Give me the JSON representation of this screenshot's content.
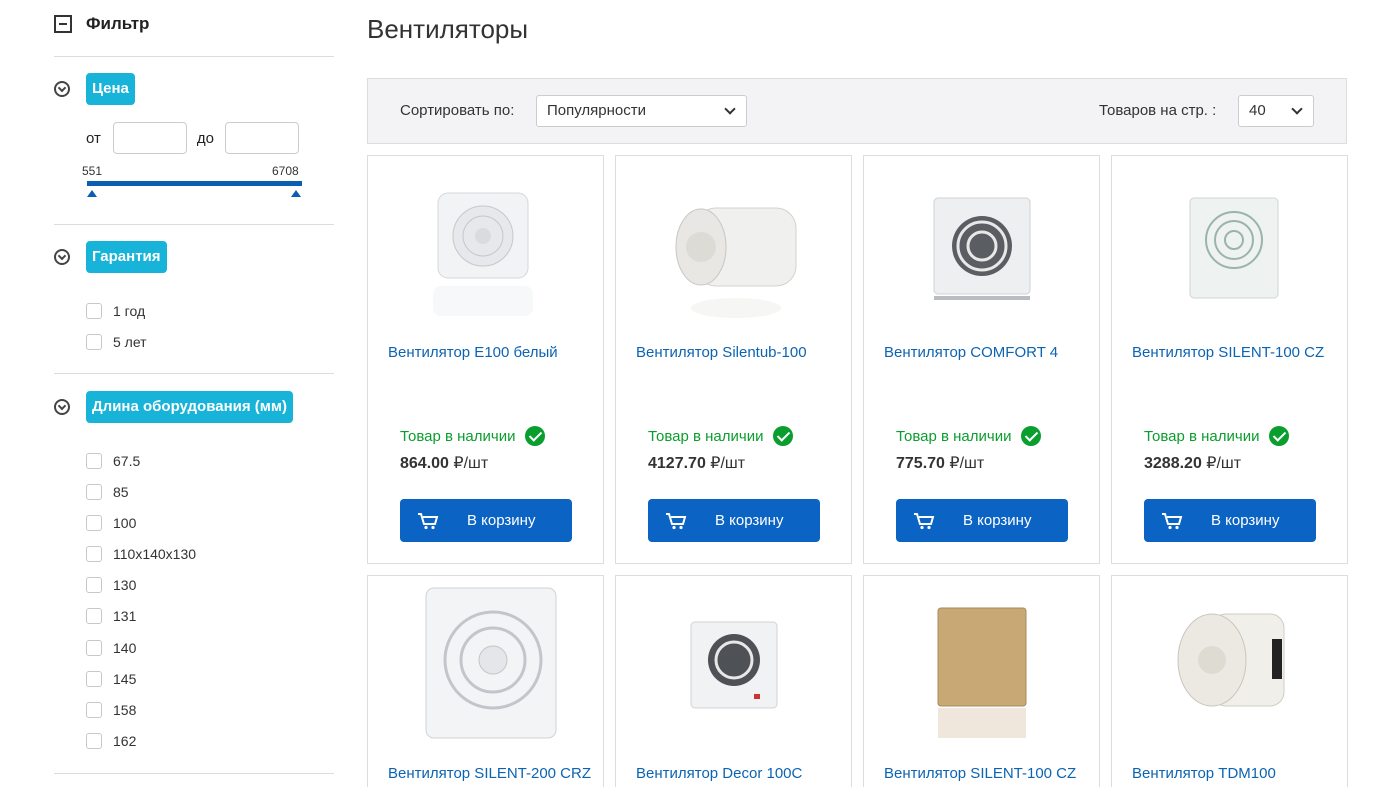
{
  "sidebar": {
    "filter_title": "Фильтр",
    "price": {
      "label": "Цена",
      "from_label": "от",
      "to_label": "до",
      "from_value": "",
      "to_value": "",
      "min": "551",
      "max": "6708"
    },
    "warranty": {
      "label": "Гарантия",
      "options": [
        "1 год",
        "5 лет"
      ]
    },
    "length": {
      "label": "Длина оборудования (мм)",
      "options": [
        "67.5",
        "85",
        "100",
        "110x140x130",
        "130",
        "131",
        "140",
        "145",
        "158",
        "162"
      ]
    }
  },
  "main": {
    "title": "Вентиляторы",
    "toolbar": {
      "sort_label": "Сортировать по:",
      "sort_value": "Популярности",
      "per_page_label": "Товаров на стр. :",
      "per_page_value": "40"
    },
    "products": [
      {
        "name": "Вентилятор E100 белый",
        "availability": "Товар в наличии",
        "price": "864.00",
        "unit": "₽/шт",
        "button": "В корзину"
      },
      {
        "name": "Вентилятор Silentub-100",
        "availability": "Товар в наличии",
        "price": "4127.70",
        "unit": "₽/шт",
        "button": "В корзину"
      },
      {
        "name": "Вентилятор COMFORT 4",
        "availability": "Товар в наличии",
        "price": "775.70",
        "unit": "₽/шт",
        "button": "В корзину"
      },
      {
        "name": "Вентилятор SILENT-100 CZ",
        "availability": "Товар в наличии",
        "price": "3288.20",
        "unit": "₽/шт",
        "button": "В корзину"
      },
      {
        "name": "Вентилятор SILENT-200 CRZ"
      },
      {
        "name": "Вентилятор Decor 100C"
      },
      {
        "name": "Вентилятор SILENT-100 CZ"
      },
      {
        "name": "Вентилятор TDM100"
      }
    ]
  }
}
